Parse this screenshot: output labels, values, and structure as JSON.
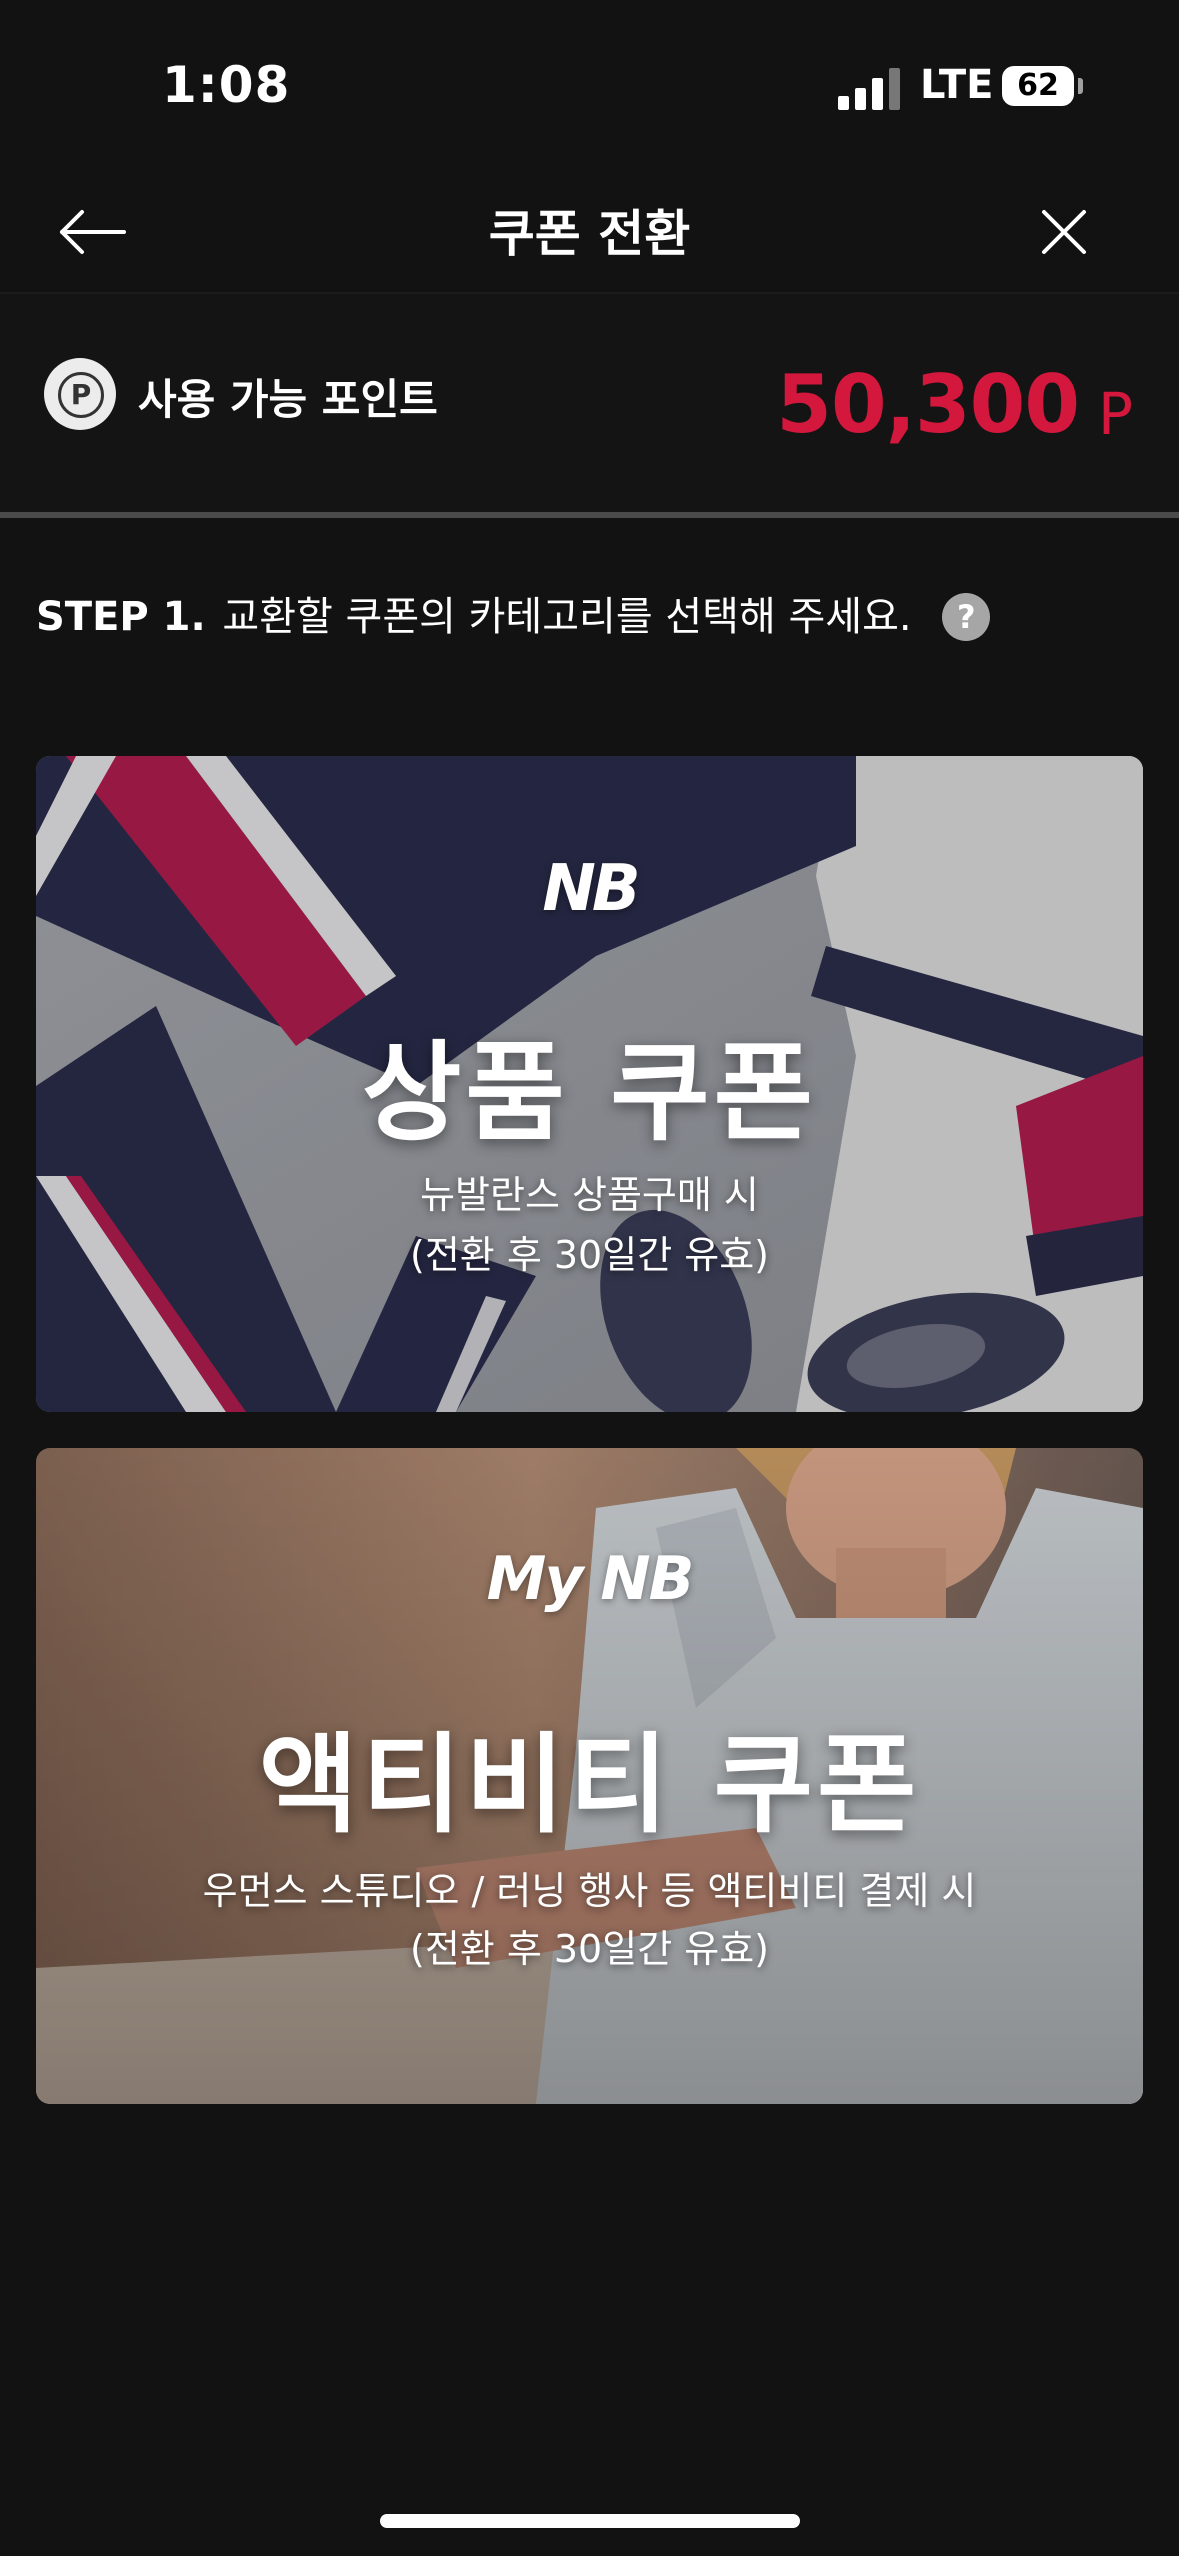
{
  "status_bar": {
    "time": "1:08",
    "network": "LTE",
    "battery": "62"
  },
  "header": {
    "title": "쿠폰 전환",
    "back_icon": "arrow-left-icon",
    "close_icon": "close-icon"
  },
  "points": {
    "icon": "point-coin-icon",
    "icon_letter": "P",
    "label": "사용 가능 포인트",
    "value": "50,300",
    "unit": "P",
    "accent_color": "#d3173d"
  },
  "step": {
    "label": "STEP 1.",
    "text": "교환할 쿠폰의 카테고리를 선택해 주세요.",
    "help": "?"
  },
  "coupons": [
    {
      "logo": "NB",
      "title": "상품 쿠폰",
      "desc_line1": "뉴발란스 상품구매 시",
      "desc_line2": "(전환 후 30일간 유효)"
    },
    {
      "logo": "My NB",
      "title": "액티비티 쿠폰",
      "desc_line1": "우먼스 스튜디오 / 러닝 행사 등 액티비티 결제 시",
      "desc_line2": "(전환 후 30일간 유효)"
    }
  ]
}
